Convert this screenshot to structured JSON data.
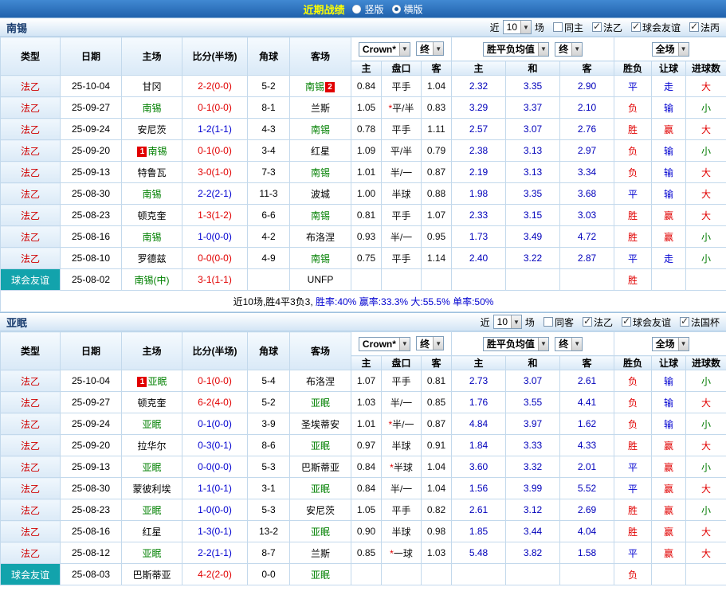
{
  "icons": {
    "dropdown": "▼",
    "check": "✓",
    "star": "*"
  },
  "topbar": {
    "title": "近期战绩",
    "radio_vertical": "竖版",
    "radio_horizontal": "横版"
  },
  "columns": {
    "type": "类型",
    "date": "日期",
    "home": "主场",
    "score": "比分(半场)",
    "corners": "角球",
    "away": "客场",
    "ah_home": "主",
    "handicap": "盘口",
    "ah_away": "客",
    "eu_home": "主",
    "eu_draw": "和",
    "eu_away": "客",
    "result": "胜负",
    "let_ball": "让球",
    "goals": "进球数"
  },
  "controls": {
    "bookmaker": "Crown*",
    "final": "终",
    "avg": "胜平负均值",
    "final2": "终",
    "scope": "全场"
  },
  "sections": [
    {
      "team": "南锡",
      "filter": {
        "prefix": "近",
        "count": "10",
        "suffix": "场",
        "same": {
          "label": "同主",
          "checked": false
        },
        "cbs": [
          {
            "label": "法乙",
            "checked": true
          },
          {
            "label": "球会友谊",
            "checked": true
          },
          {
            "label": "法丙",
            "checked": true
          }
        ]
      },
      "rows": [
        {
          "type": "法乙",
          "friendly": false,
          "date": "25-10-04",
          "home": {
            "n": "甘冈",
            "focus": false
          },
          "score": {
            "t": "2-2(0-0)",
            "c": "r"
          },
          "corners": "5-2",
          "away": {
            "n": "南锡",
            "focus": true,
            "badge": "2",
            "pos": "after"
          },
          "ah": [
            "0.84",
            "平手",
            "1.04"
          ],
          "star": false,
          "eu": [
            "2.32",
            "3.35",
            "2.90"
          ],
          "res": {
            "t": "平",
            "c": "b"
          },
          "let": {
            "t": "走",
            "c": "b"
          },
          "big": {
            "t": "大",
            "c": "r"
          }
        },
        {
          "type": "法乙",
          "friendly": false,
          "date": "25-09-27",
          "home": {
            "n": "南锡",
            "focus": true
          },
          "score": {
            "t": "0-1(0-0)",
            "c": "r"
          },
          "corners": "8-1",
          "away": {
            "n": "兰斯",
            "focus": false
          },
          "ah": [
            "1.05",
            "平/半",
            "0.83"
          ],
          "star": true,
          "eu": [
            "3.29",
            "3.37",
            "2.10"
          ],
          "res": {
            "t": "负",
            "c": "r"
          },
          "let": {
            "t": "输",
            "c": "b"
          },
          "big": {
            "t": "小",
            "c": "g"
          }
        },
        {
          "type": "法乙",
          "friendly": false,
          "date": "25-09-24",
          "home": {
            "n": "安尼茨",
            "focus": false
          },
          "score": {
            "t": "1-2(1-1)",
            "c": "b"
          },
          "corners": "4-3",
          "away": {
            "n": "南锡",
            "focus": true
          },
          "ah": [
            "0.78",
            "平手",
            "1.11"
          ],
          "star": false,
          "eu": [
            "2.57",
            "3.07",
            "2.76"
          ],
          "res": {
            "t": "胜",
            "c": "r"
          },
          "let": {
            "t": "赢",
            "c": "r"
          },
          "big": {
            "t": "大",
            "c": "r"
          }
        },
        {
          "type": "法乙",
          "friendly": false,
          "date": "25-09-20",
          "home": {
            "n": "南锡",
            "focus": true,
            "badge": "1",
            "pos": "before"
          },
          "score": {
            "t": "0-1(0-0)",
            "c": "r"
          },
          "corners": "3-4",
          "away": {
            "n": "红星",
            "focus": false
          },
          "ah": [
            "1.09",
            "平/半",
            "0.79"
          ],
          "star": false,
          "eu": [
            "2.38",
            "3.13",
            "2.97"
          ],
          "res": {
            "t": "负",
            "c": "r"
          },
          "let": {
            "t": "输",
            "c": "b"
          },
          "big": {
            "t": "小",
            "c": "g"
          }
        },
        {
          "type": "法乙",
          "friendly": false,
          "date": "25-09-13",
          "home": {
            "n": "特鲁瓦",
            "focus": false
          },
          "score": {
            "t": "3-0(1-0)",
            "c": "r"
          },
          "corners": "7-3",
          "away": {
            "n": "南锡",
            "focus": true
          },
          "ah": [
            "1.01",
            "半/一",
            "0.87"
          ],
          "star": false,
          "eu": [
            "2.19",
            "3.13",
            "3.34"
          ],
          "res": {
            "t": "负",
            "c": "r"
          },
          "let": {
            "t": "输",
            "c": "b"
          },
          "big": {
            "t": "大",
            "c": "r"
          }
        },
        {
          "type": "法乙",
          "friendly": false,
          "date": "25-08-30",
          "home": {
            "n": "南锡",
            "focus": true
          },
          "score": {
            "t": "2-2(2-1)",
            "c": "b"
          },
          "corners": "11-3",
          "away": {
            "n": "波城",
            "focus": false
          },
          "ah": [
            "1.00",
            "半球",
            "0.88"
          ],
          "star": false,
          "eu": [
            "1.98",
            "3.35",
            "3.68"
          ],
          "res": {
            "t": "平",
            "c": "b"
          },
          "let": {
            "t": "输",
            "c": "b"
          },
          "big": {
            "t": "大",
            "c": "r"
          }
        },
        {
          "type": "法乙",
          "friendly": false,
          "date": "25-08-23",
          "home": {
            "n": "顿克奎",
            "focus": false
          },
          "score": {
            "t": "1-3(1-2)",
            "c": "r"
          },
          "corners": "6-6",
          "away": {
            "n": "南锡",
            "focus": true
          },
          "ah": [
            "0.81",
            "平手",
            "1.07"
          ],
          "star": false,
          "eu": [
            "2.33",
            "3.15",
            "3.03"
          ],
          "res": {
            "t": "胜",
            "c": "r"
          },
          "let": {
            "t": "赢",
            "c": "r"
          },
          "big": {
            "t": "大",
            "c": "r"
          }
        },
        {
          "type": "法乙",
          "friendly": false,
          "date": "25-08-16",
          "home": {
            "n": "南锡",
            "focus": true
          },
          "score": {
            "t": "1-0(0-0)",
            "c": "b"
          },
          "corners": "4-2",
          "away": {
            "n": "布洛涅",
            "focus": false
          },
          "ah": [
            "0.93",
            "半/一",
            "0.95"
          ],
          "star": false,
          "eu": [
            "1.73",
            "3.49",
            "4.72"
          ],
          "res": {
            "t": "胜",
            "c": "r"
          },
          "let": {
            "t": "赢",
            "c": "r"
          },
          "big": {
            "t": "小",
            "c": "g"
          }
        },
        {
          "type": "法乙",
          "friendly": false,
          "date": "25-08-10",
          "home": {
            "n": "罗德兹",
            "focus": false
          },
          "score": {
            "t": "0-0(0-0)",
            "c": "r"
          },
          "corners": "4-9",
          "away": {
            "n": "南锡",
            "focus": true
          },
          "ah": [
            "0.75",
            "平手",
            "1.14"
          ],
          "star": false,
          "eu": [
            "2.40",
            "3.22",
            "2.87"
          ],
          "res": {
            "t": "平",
            "c": "b"
          },
          "let": {
            "t": "走",
            "c": "b"
          },
          "big": {
            "t": "小",
            "c": "g"
          }
        },
        {
          "type": "球会友谊",
          "friendly": true,
          "date": "25-08-02",
          "home": {
            "n": "南锡(中)",
            "focus": true
          },
          "score": {
            "t": "3-1(1-1)",
            "c": "r"
          },
          "corners": "",
          "away": {
            "n": "UNFP",
            "focus": false
          },
          "ah": [
            "",
            "",
            ""
          ],
          "star": false,
          "eu": [
            "",
            "",
            ""
          ],
          "res": {
            "t": "胜",
            "c": "r"
          },
          "let": {
            "t": "",
            "c": "b"
          },
          "big": {
            "t": "",
            "c": "r"
          }
        }
      ],
      "summary": [
        {
          "text": "近10场,胜4平3负3, ",
          "c": "k"
        },
        {
          "text": "胜率:40% ",
          "c": "b"
        },
        {
          "text": "赢率:33.3% ",
          "c": "b"
        },
        {
          "text": "大:55.5% ",
          "c": "b"
        },
        {
          "text": "单率:50%",
          "c": "b"
        }
      ]
    },
    {
      "team": "亚眠",
      "filter": {
        "prefix": "近",
        "count": "10",
        "suffix": "场",
        "same": {
          "label": "同客",
          "checked": false
        },
        "cbs": [
          {
            "label": "法乙",
            "checked": true
          },
          {
            "label": "球会友谊",
            "checked": true
          },
          {
            "label": "法国杯",
            "checked": true
          }
        ]
      },
      "rows": [
        {
          "type": "法乙",
          "friendly": false,
          "date": "25-10-04",
          "home": {
            "n": "亚眠",
            "focus": true,
            "badge": "1",
            "pos": "before"
          },
          "score": {
            "t": "0-1(0-0)",
            "c": "r"
          },
          "corners": "5-4",
          "away": {
            "n": "布洛涅",
            "focus": false
          },
          "ah": [
            "1.07",
            "平手",
            "0.81"
          ],
          "star": false,
          "eu": [
            "2.73",
            "3.07",
            "2.61"
          ],
          "res": {
            "t": "负",
            "c": "r"
          },
          "let": {
            "t": "输",
            "c": "b"
          },
          "big": {
            "t": "小",
            "c": "g"
          }
        },
        {
          "type": "法乙",
          "friendly": false,
          "date": "25-09-27",
          "home": {
            "n": "顿克奎",
            "focus": false
          },
          "score": {
            "t": "6-2(4-0)",
            "c": "r"
          },
          "corners": "5-2",
          "away": {
            "n": "亚眠",
            "focus": true
          },
          "ah": [
            "1.03",
            "半/一",
            "0.85"
          ],
          "star": false,
          "eu": [
            "1.76",
            "3.55",
            "4.41"
          ],
          "res": {
            "t": "负",
            "c": "r"
          },
          "let": {
            "t": "输",
            "c": "b"
          },
          "big": {
            "t": "大",
            "c": "r"
          }
        },
        {
          "type": "法乙",
          "friendly": false,
          "date": "25-09-24",
          "home": {
            "n": "亚眠",
            "focus": true
          },
          "score": {
            "t": "0-1(0-0)",
            "c": "b"
          },
          "corners": "3-9",
          "away": {
            "n": "圣埃蒂安",
            "focus": false
          },
          "ah": [
            "1.01",
            "半/一",
            "0.87"
          ],
          "star": true,
          "eu": [
            "4.84",
            "3.97",
            "1.62"
          ],
          "res": {
            "t": "负",
            "c": "r"
          },
          "let": {
            "t": "输",
            "c": "b"
          },
          "big": {
            "t": "小",
            "c": "g"
          }
        },
        {
          "type": "法乙",
          "friendly": false,
          "date": "25-09-20",
          "home": {
            "n": "拉华尔",
            "focus": false
          },
          "score": {
            "t": "0-3(0-1)",
            "c": "b"
          },
          "corners": "8-6",
          "away": {
            "n": "亚眠",
            "focus": true
          },
          "ah": [
            "0.97",
            "半球",
            "0.91"
          ],
          "star": false,
          "eu": [
            "1.84",
            "3.33",
            "4.33"
          ],
          "res": {
            "t": "胜",
            "c": "r"
          },
          "let": {
            "t": "赢",
            "c": "r"
          },
          "big": {
            "t": "大",
            "c": "r"
          }
        },
        {
          "type": "法乙",
          "friendly": false,
          "date": "25-09-13",
          "home": {
            "n": "亚眠",
            "focus": true
          },
          "score": {
            "t": "0-0(0-0)",
            "c": "b"
          },
          "corners": "5-3",
          "away": {
            "n": "巴斯蒂亚",
            "focus": false
          },
          "ah": [
            "0.84",
            "半球",
            "1.04"
          ],
          "star": true,
          "eu": [
            "3.60",
            "3.32",
            "2.01"
          ],
          "res": {
            "t": "平",
            "c": "b"
          },
          "let": {
            "t": "赢",
            "c": "r"
          },
          "big": {
            "t": "小",
            "c": "g"
          }
        },
        {
          "type": "法乙",
          "friendly": false,
          "date": "25-08-30",
          "home": {
            "n": "蒙彼利埃",
            "focus": false
          },
          "score": {
            "t": "1-1(0-1)",
            "c": "b"
          },
          "corners": "3-1",
          "away": {
            "n": "亚眠",
            "focus": true
          },
          "ah": [
            "0.84",
            "半/一",
            "1.04"
          ],
          "star": false,
          "eu": [
            "1.56",
            "3.99",
            "5.52"
          ],
          "res": {
            "t": "平",
            "c": "b"
          },
          "let": {
            "t": "赢",
            "c": "r"
          },
          "big": {
            "t": "大",
            "c": "r"
          }
        },
        {
          "type": "法乙",
          "friendly": false,
          "date": "25-08-23",
          "home": {
            "n": "亚眠",
            "focus": true
          },
          "score": {
            "t": "1-0(0-0)",
            "c": "b"
          },
          "corners": "5-3",
          "away": {
            "n": "安尼茨",
            "focus": false
          },
          "ah": [
            "1.05",
            "平手",
            "0.82"
          ],
          "star": false,
          "eu": [
            "2.61",
            "3.12",
            "2.69"
          ],
          "res": {
            "t": "胜",
            "c": "r"
          },
          "let": {
            "t": "赢",
            "c": "r"
          },
          "big": {
            "t": "小",
            "c": "g"
          }
        },
        {
          "type": "法乙",
          "friendly": false,
          "date": "25-08-16",
          "home": {
            "n": "红星",
            "focus": false
          },
          "score": {
            "t": "1-3(0-1)",
            "c": "b"
          },
          "corners": "13-2",
          "away": {
            "n": "亚眠",
            "focus": true
          },
          "ah": [
            "0.90",
            "半球",
            "0.98"
          ],
          "star": false,
          "eu": [
            "1.85",
            "3.44",
            "4.04"
          ],
          "res": {
            "t": "胜",
            "c": "r"
          },
          "let": {
            "t": "赢",
            "c": "r"
          },
          "big": {
            "t": "大",
            "c": "r"
          }
        },
        {
          "type": "法乙",
          "friendly": false,
          "date": "25-08-12",
          "home": {
            "n": "亚眠",
            "focus": true
          },
          "score": {
            "t": "2-2(1-1)",
            "c": "b"
          },
          "corners": "8-7",
          "away": {
            "n": "兰斯",
            "focus": false
          },
          "ah": [
            "0.85",
            "一球",
            "1.03"
          ],
          "star": true,
          "eu": [
            "5.48",
            "3.82",
            "1.58"
          ],
          "res": {
            "t": "平",
            "c": "b"
          },
          "let": {
            "t": "赢",
            "c": "r"
          },
          "big": {
            "t": "大",
            "c": "r"
          }
        },
        {
          "type": "球会友谊",
          "friendly": true,
          "date": "25-08-03",
          "home": {
            "n": "巴斯蒂亚",
            "focus": false
          },
          "score": {
            "t": "4-2(2-0)",
            "c": "r"
          },
          "corners": "0-0",
          "away": {
            "n": "亚眠",
            "focus": true
          },
          "ah": [
            "",
            "",
            ""
          ],
          "star": false,
          "eu": [
            "",
            "",
            ""
          ],
          "res": {
            "t": "负",
            "c": "r"
          },
          "let": {
            "t": "",
            "c": "b"
          },
          "big": {
            "t": "",
            "c": "r"
          }
        }
      ],
      "summary": []
    }
  ]
}
